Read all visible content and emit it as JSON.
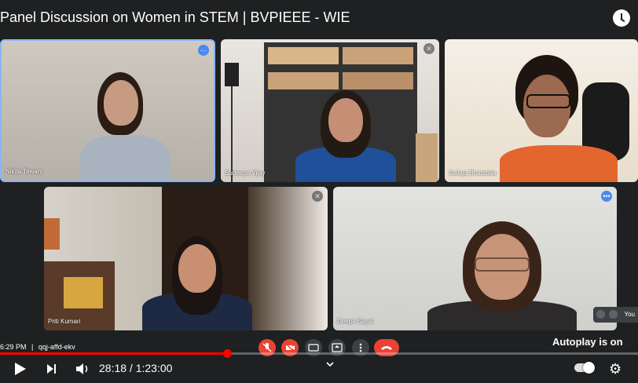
{
  "video": {
    "title": "Panel Discussion on Women in STEM | BVPIEEE - WIE",
    "current_time": "28:18",
    "duration": "1:23:00",
    "time_display": "28:18 / 1:23:00",
    "progress_fraction": 0.356,
    "autoplay_label": "Autoplay is on"
  },
  "meet": {
    "clock_time": "6:29 PM",
    "separator": "|",
    "meeting_code": "qqj-affd-ekv",
    "self_label": "You"
  },
  "participants": [
    {
      "name": "Nikita Tewary",
      "badge": "dots"
    },
    {
      "name": "Sudeepa Vijay",
      "badge": "mic-off"
    },
    {
      "name": "Sailaja Bharatala",
      "badge": ""
    },
    {
      "name": "Priti Kumari",
      "badge": "mic-off"
    },
    {
      "name": "Deepa Sayal",
      "badge": "speaking"
    }
  ],
  "colors": {
    "accent_blue": "#4a89f3",
    "end_call_red": "#ea4335",
    "progress_red": "#ff0000",
    "background": "#1f2021"
  },
  "icons": {
    "clock": "clock-icon",
    "mic": "mic-off-icon",
    "camera": "camera-off-icon",
    "captions": "captions-icon",
    "present": "present-icon",
    "more": "more-vert-icon",
    "end_call": "end-call-icon",
    "play": "play-icon",
    "next": "next-icon",
    "volume": "volume-icon",
    "chevron": "chevron-down-icon",
    "settings": "settings-gear-icon"
  }
}
